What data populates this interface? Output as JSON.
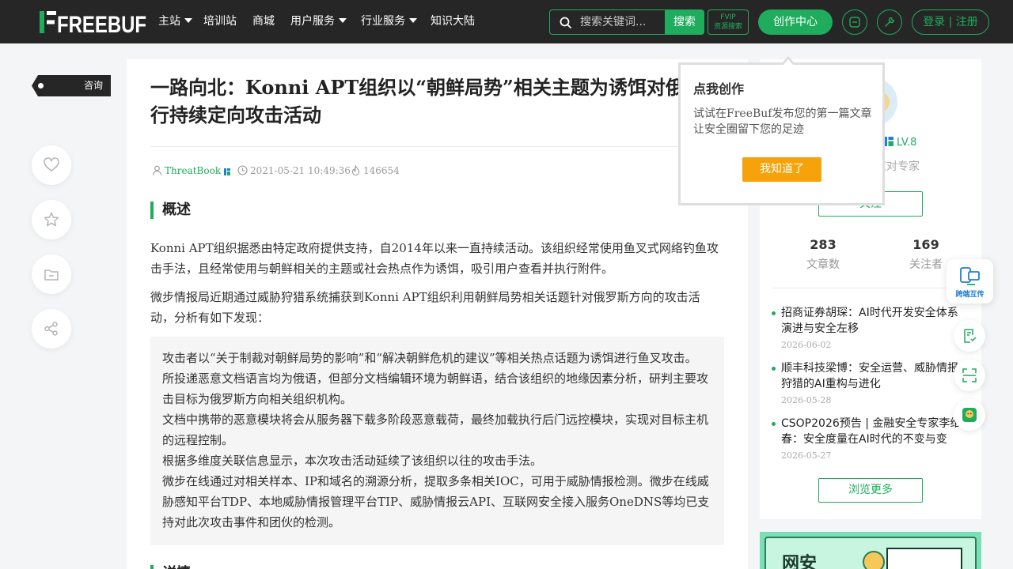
{
  "nav": {
    "logo_text": "FREEBUF",
    "items": [
      {
        "label": "主站",
        "dropdown": true
      },
      {
        "label": "培训站",
        "dropdown": false
      },
      {
        "label": "商城",
        "dropdown": false
      },
      {
        "label": "用户服务",
        "dropdown": true
      },
      {
        "label": "行业服务",
        "dropdown": true
      },
      {
        "label": "知识大陆",
        "dropdown": false
      }
    ],
    "search_placeholder": "搜索关键词...",
    "search_button": "搜索",
    "fvip_line1": "FVIP",
    "fvip_line2": "资源搜索",
    "create_button": "创作中心",
    "app_icon": "app-download-icon",
    "tools_icon": "wrench-icon",
    "login_label": "登录 | 注册"
  },
  "left": {
    "category_tag": "咨询",
    "actions": [
      "like-icon",
      "star-icon",
      "folder-icon",
      "share-icon"
    ]
  },
  "article": {
    "title": "一路向北：Konni APT组织以“朝鲜局势”相关主题为诱饵对俄进行持续定向攻击活动",
    "author": "ThreatBook",
    "datetime": "2021-05-21 10:49:36",
    "views": "146654",
    "section_overview": "概述",
    "paragraph1": "Konni APT组织据悉由特定政府提供支持，自2014年以来一直持续活动。该组织经常使用鱼叉式网络钓鱼攻击手法，且经常使用与朝鲜相关的主题或社会热点作为诱饵，吸引用户查看并执行附件。",
    "paragraph2": "微步情报局近期通过威胁狩猎系统捕获到Konni APT组织利用朝鲜局势相关话题针对俄罗斯方向的攻击活动，分析有如下发现：",
    "findings": [
      "攻击者以“关于制裁对朝鲜局势的影响”和“解决朝鲜危机的建议”等相关热点话题为诱饵进行鱼叉攻击。",
      "所投递恶意文档语言均为俄语，但部分文档编辑环境为朝鲜语，结合该组织的地缘因素分析，研判主要攻击目标为俄罗斯方向相关组织机构。",
      "文档中携带的恶意模块将会从服务器下载多阶段恶意载荷，最终加载执行后门远控模块，实现对目标主机的远程控制。",
      "根据多维度关联信息显示，本次攻击活动延续了该组织以往的攻击手法。",
      "微步在线通过对相关样本、IP和域名的溯源分析，提取多条相关IOC，可用于威胁情报检测。微步在线威胁感知平台TDP、本地威胁情报管理平台TIP、威胁情报云API、互联网安全接入服务OneDNS等均已支持对此次攻击事件和团伙的检测。"
    ],
    "section_details": "详情"
  },
  "sidebar": {
    "level": "LV.8",
    "role": "协应对专家",
    "follow_button": "关注",
    "stats": [
      {
        "value": "283",
        "label": "文章数"
      },
      {
        "value": "169",
        "label": "关注者"
      }
    ],
    "related": [
      {
        "title": "招商证券胡琛：AI时代开发安全体系演进与安全左移",
        "date": "2026-06-02"
      },
      {
        "title": "顺丰科技梁博：安全运营、威胁情报狩猎的AI重构与进化",
        "date": "2026-05-28"
      },
      {
        "title": "CSOP2026预告 | 金融安全专家李维春：安全度量在AI时代的不变与变",
        "date": "2026-05-27"
      }
    ],
    "more_button": "浏览更多",
    "banner_text": "网安"
  },
  "popover": {
    "title": "点我创作",
    "text": "试试在FreeBuf发布您的第一篇文章 让安全圈留下您的足迹",
    "button": "我知道了"
  },
  "floating": {
    "cross_post_label": "跨端互传",
    "buttons": [
      "feedback-icon",
      "scan-icon",
      "miniprogram-icon"
    ]
  },
  "colors": {
    "brand_green": "#1fac5c",
    "nav_bg": "#262626",
    "popover_button": "#f6a30b",
    "page_bg": "#f4f5f6"
  }
}
